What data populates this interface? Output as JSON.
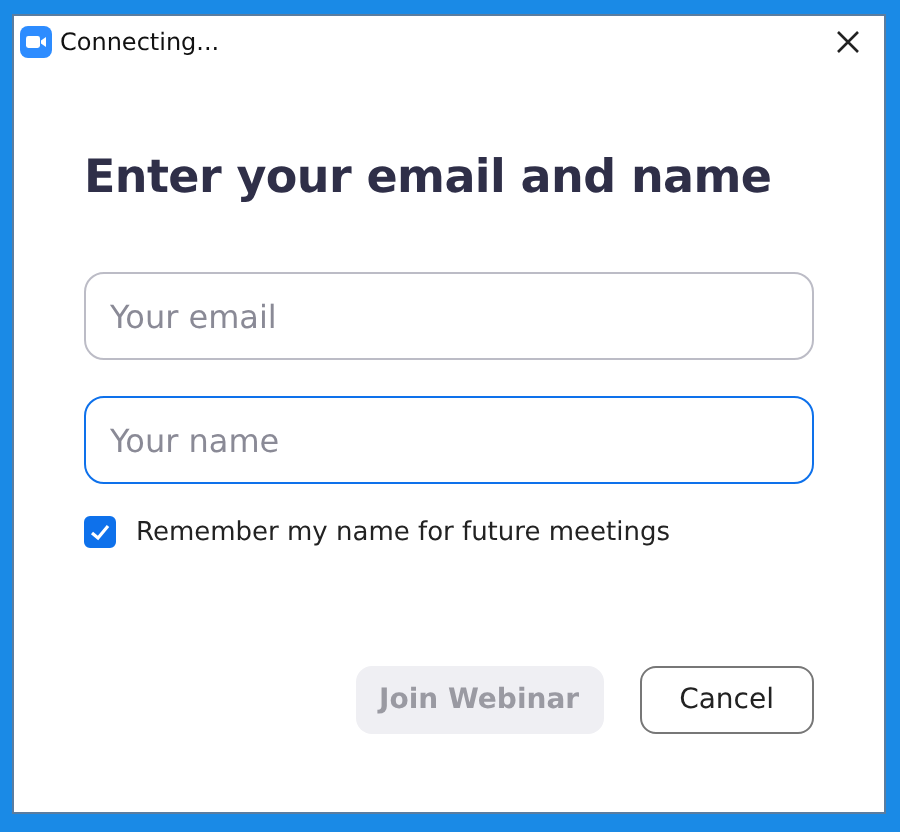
{
  "window": {
    "title": "Connecting..."
  },
  "heading": "Enter your email and name",
  "fields": [
    {
      "placeholder": "Your email",
      "focused": false
    },
    {
      "placeholder": "Your name",
      "focused": true
    }
  ],
  "remember": {
    "label": "Remember my name for future meetings",
    "checked": true
  },
  "buttons": [
    {
      "label": "Join Webinar",
      "kind": "primary",
      "disabled": true
    },
    {
      "label": "Cancel",
      "kind": "secondary",
      "disabled": false
    }
  ]
}
